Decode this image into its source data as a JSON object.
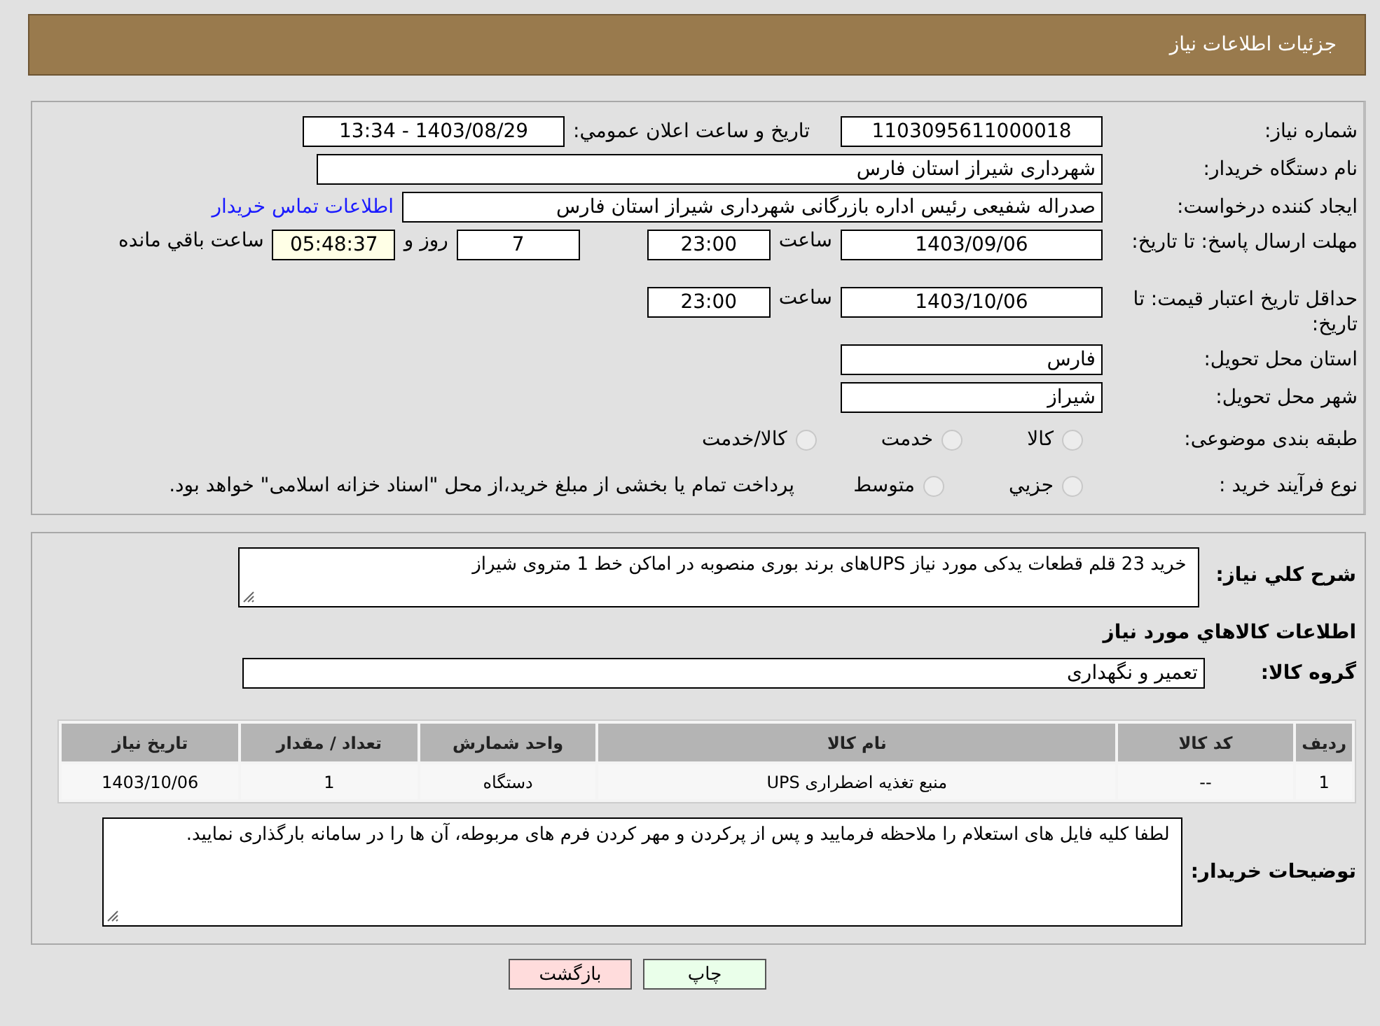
{
  "header": {
    "title": "جزئیات اطلاعات نیاز"
  },
  "need_info": {
    "need_number": {
      "label": "شماره نیاز:",
      "value": "1103095611000018"
    },
    "announce": {
      "label": "تاریخ و ساعت اعلان عمومي:",
      "value": "1403/08/29 - 13:34"
    },
    "buyer_org": {
      "label": "نام دستگاه خریدار:",
      "value": "شهرداری شیراز استان فارس"
    },
    "creator": {
      "label": "ایجاد کننده درخواست:",
      "value": "صدراله شفیعی رئیس اداره بازرگانی  شهرداری شیراز استان فارس",
      "contact_link": "اطلاعات تماس خریدار"
    },
    "response_deadline": {
      "label": "مهلت ارسال پاسخ: تا تاریخ:",
      "date": "1403/09/06",
      "time_label": "ساعت",
      "time": "23:00",
      "days": "7",
      "days_label": "روز و",
      "remaining": "05:48:37",
      "remaining_label": "ساعت باقي مانده"
    },
    "price_validity": {
      "label": "حداقل تاریخ اعتبار قیمت: تا تاریخ:",
      "date": "1403/10/06",
      "time_label": "ساعت",
      "time": "23:00"
    },
    "delivery_province": {
      "label": "استان محل تحویل:",
      "value": "فارس"
    },
    "delivery_city": {
      "label": "شهر محل تحویل:",
      "value": "شیراز"
    },
    "category": {
      "label": "طبقه بندی موضوعی:",
      "options": [
        {
          "label": "کالا",
          "selected": false
        },
        {
          "label": "خدمت",
          "selected": false
        },
        {
          "label": "کالا/خدمت",
          "selected": false
        }
      ]
    },
    "purchase_process": {
      "label": "نوع فرآیند خرید :",
      "options": [
        {
          "label": "جزيي",
          "selected": false
        },
        {
          "label": "متوسط",
          "selected": false
        }
      ],
      "note": "پرداخت تمام یا بخشی از مبلغ خرید،از محل \"اسناد خزانه اسلامی\" خواهد بود."
    }
  },
  "summary": {
    "label": "شرح کلي نیاز:",
    "value": "خرید 23 قلم قطعات یدکی مورد نیاز  UPSهای برند بوری منصوبه در اماکن خط 1 متروی شیراز"
  },
  "goods_title": "اطلاعات کالاهاي مورد نیاز",
  "goods_group": {
    "label": "گروه کالا:",
    "value": "تعمیر و نگهداری"
  },
  "items_table": {
    "columns": [
      "ردیف",
      "کد کالا",
      "نام کالا",
      "واحد شمارش",
      "تعداد / مقدار",
      "تاریخ نیاز"
    ],
    "rows": [
      [
        "1",
        "--",
        "منبع تغذیه اضطراری UPS",
        "دستگاه",
        "1",
        "1403/10/06"
      ]
    ]
  },
  "buyer_notes": {
    "label": "توضیحات خریدار:",
    "value": "لطفا کلیه فایل های استعلام را ملاحظه فرمایید و پس از پرکردن و مهر کردن فرم های مربوطه، آن ها را در سامانه بارگذاری نمایید."
  },
  "buttons": [
    {
      "label": "چاپ",
      "kind": "print"
    },
    {
      "label": "بازگشت",
      "kind": "back"
    }
  ]
}
